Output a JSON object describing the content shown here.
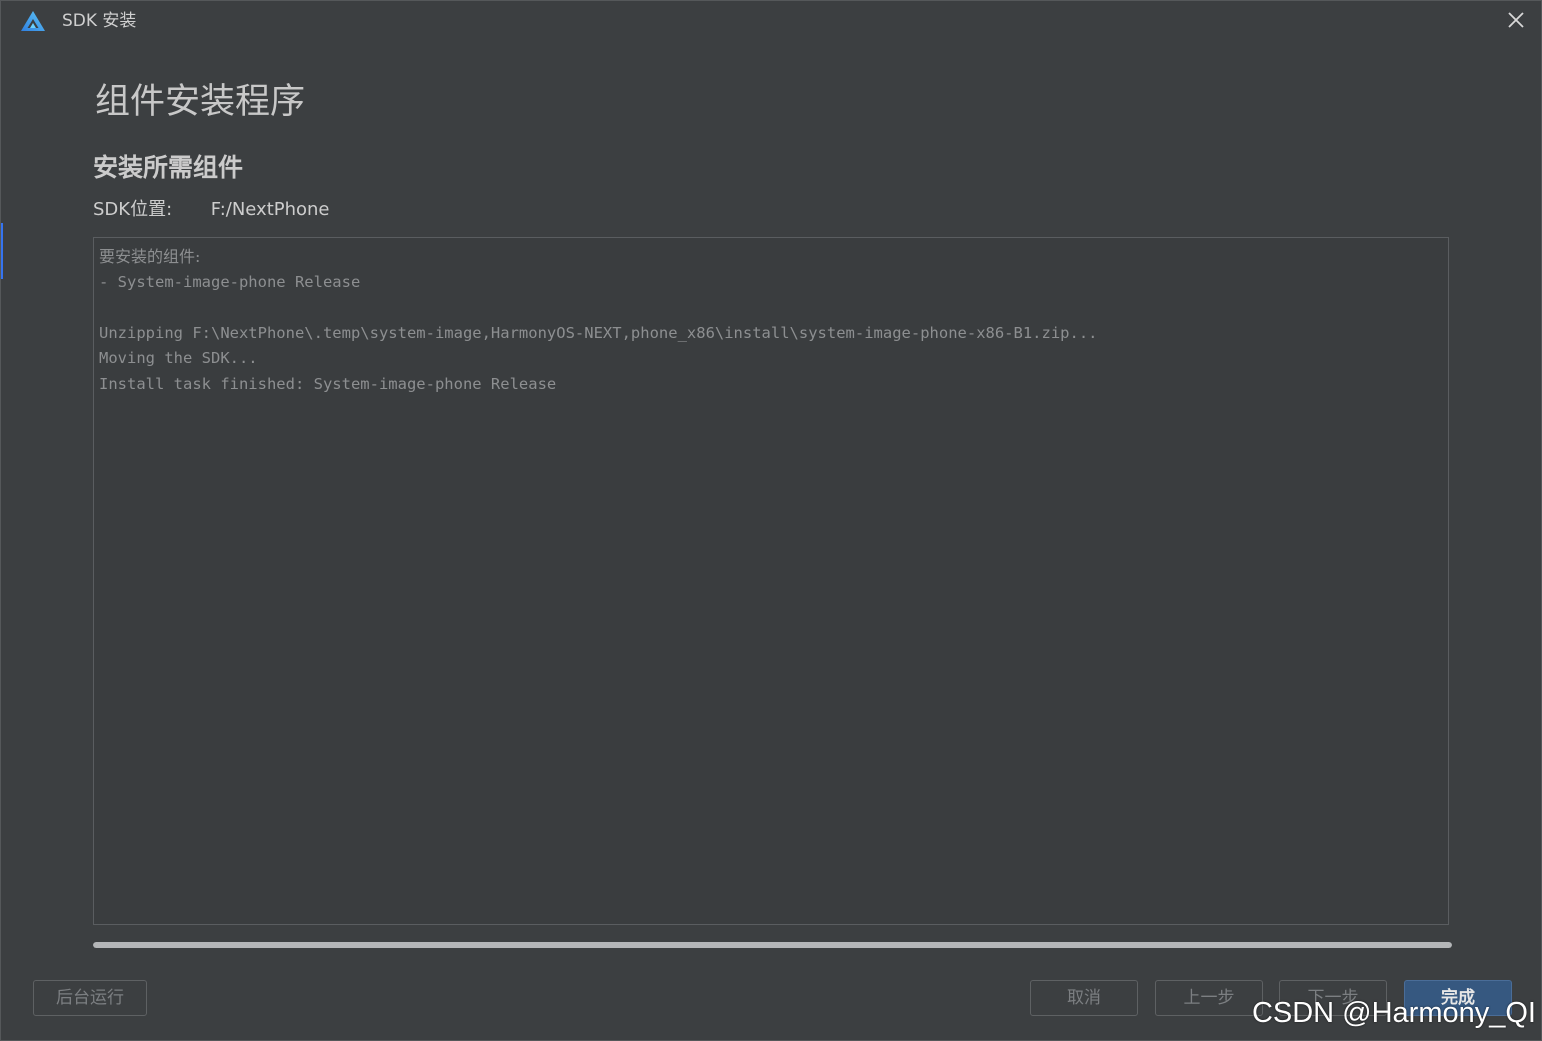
{
  "window": {
    "title": "SDK 安装",
    "logo_icon": "harmony-logo-icon",
    "close_icon": "close-icon"
  },
  "page": {
    "title": "组件安装程序",
    "section_title": "安装所需组件",
    "sdk_location_label": "SDK位置:",
    "sdk_location_value": "F:/NextPhone"
  },
  "console": {
    "lines": [
      "要安装的组件:",
      "- System-image-phone Release",
      "",
      "Unzipping F:\\NextPhone\\.temp\\system-image,HarmonyOS-NEXT,phone_x86\\install\\system-image-phone-x86-B1.zip...",
      "Moving the SDK...",
      "Install task finished: System-image-phone Release"
    ]
  },
  "progress": {
    "fraction": 1.0
  },
  "buttons": {
    "background": "后台运行",
    "cancel": "取消",
    "prev": "上一步",
    "next": "下一步",
    "finish": "完成"
  },
  "watermark": "CSDN @Harmony_QI",
  "colors": {
    "background": "#3c3f41",
    "accent": "#3574f0",
    "primary_button": "#365880"
  }
}
